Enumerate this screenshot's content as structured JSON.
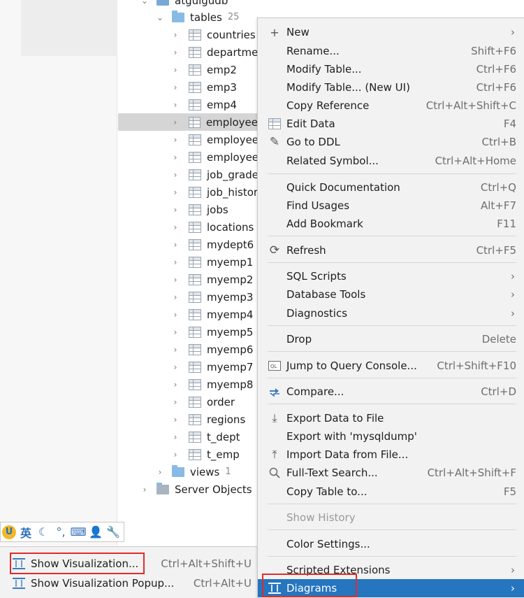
{
  "tree": {
    "db_name": "atguigudb",
    "tables_label": "tables",
    "tables_count": "25",
    "tables": [
      "countries",
      "departmer",
      "emp2",
      "emp3",
      "emp4",
      "employee",
      "employee",
      "employee",
      "job_grade",
      "job_histor",
      "jobs",
      "locations",
      "mydept6",
      "myemp1",
      "myemp2",
      "myemp3",
      "myemp4",
      "myemp5",
      "myemp6",
      "myemp7",
      "myemp8",
      "order",
      "regions",
      "t_dept",
      "t_emp"
    ],
    "views_label": "views",
    "views_count": "1",
    "server_objects_label": "Server Objects"
  },
  "ime": {
    "lang": "英"
  },
  "submenu": {
    "items": [
      {
        "label": "Show Visualization...",
        "shortcut": "Ctrl+Alt+Shift+U"
      },
      {
        "label": "Show Visualization Popup...",
        "shortcut": "Ctrl+Alt+U"
      }
    ]
  },
  "context_menu": {
    "new": "New",
    "rename": "Rename...",
    "rename_sc": "Shift+F6",
    "modify_table": "Modify Table...",
    "modify_table_sc": "Ctrl+F6",
    "modify_table_new": "Modify Table... (New UI)",
    "modify_table_new_sc": "Ctrl+F6",
    "copy_reference": "Copy Reference",
    "copy_reference_sc": "Ctrl+Alt+Shift+C",
    "edit_data": "Edit Data",
    "edit_data_sc": "F4",
    "go_to_ddl": "Go to DDL",
    "go_to_ddl_sc": "Ctrl+B",
    "related_symbol": "Related Symbol...",
    "related_symbol_sc": "Ctrl+Alt+Home",
    "quick_doc": "Quick Documentation",
    "quick_doc_sc": "Ctrl+Q",
    "find_usages": "Find Usages",
    "find_usages_sc": "Alt+F7",
    "add_bookmark": "Add Bookmark",
    "add_bookmark_sc": "F11",
    "refresh": "Refresh",
    "refresh_sc": "Ctrl+F5",
    "sql_scripts": "SQL Scripts",
    "database_tools": "Database Tools",
    "diagnostics": "Diagnostics",
    "drop": "Drop",
    "drop_sc": "Delete",
    "jump_query_console": "Jump to Query Console...",
    "jump_query_console_sc": "Ctrl+Shift+F10",
    "compare": "Compare...",
    "compare_sc": "Ctrl+D",
    "export_data": "Export Data to File",
    "export_mysqldump": "Export with 'mysqldump'",
    "import_data": "Import Data from File...",
    "full_text_search": "Full-Text Search...",
    "full_text_search_sc": "Ctrl+Alt+Shift+F",
    "copy_table_to": "Copy Table to...",
    "copy_table_to_sc": "F5",
    "show_history": "Show History",
    "color_settings": "Color Settings...",
    "scripted_extensions": "Scripted Extensions",
    "diagrams": "Diagrams"
  },
  "colors": {
    "menu_bg": "#f2f2f2",
    "selection": "#2675bf",
    "tree_selection": "#d5d5d5",
    "highlight_box": "#e02b2b"
  }
}
